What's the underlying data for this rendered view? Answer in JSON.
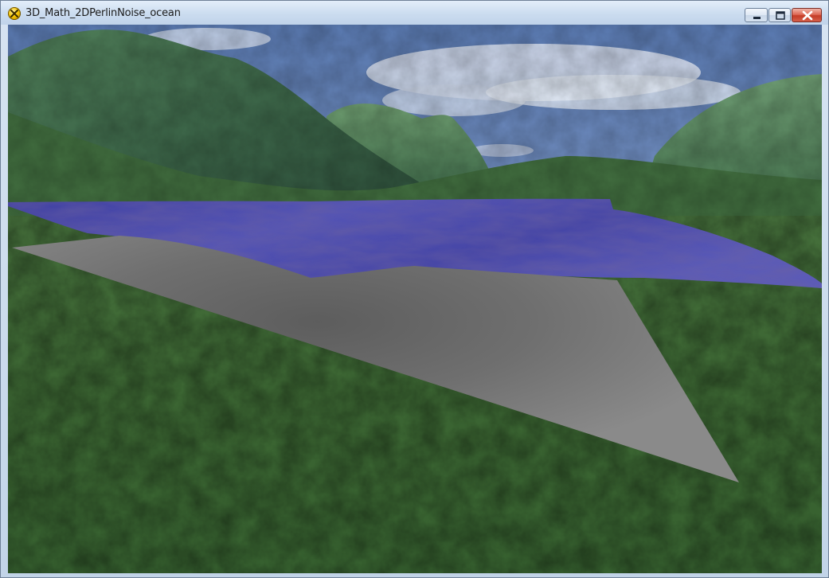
{
  "window": {
    "title": "3D_Math_2DPerlinNoise_ocean",
    "app_icon": "directx-icon",
    "controls": {
      "minimize": "minimize-icon",
      "maximize": "maximize-icon",
      "close": "close-icon"
    }
  },
  "scene": {
    "sky_color": "#6f8fc0",
    "mountain_color": "#3f6b45",
    "water_color": "#4a4aa8",
    "ground_color": "#3e6a33",
    "plane_color": "#7c7c7c"
  }
}
